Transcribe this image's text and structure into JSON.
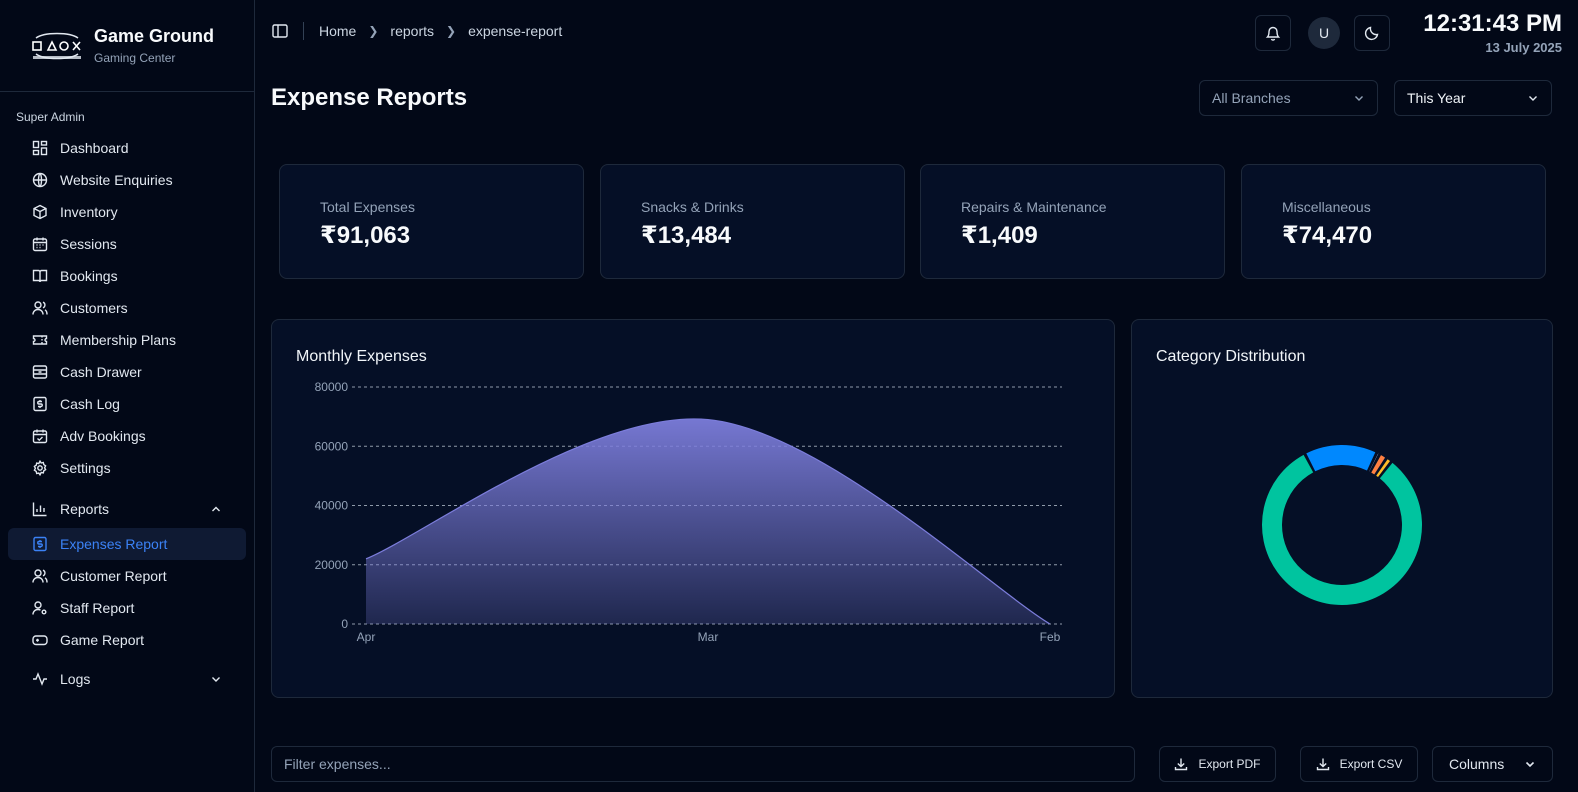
{
  "brand": {
    "name": "Game Ground",
    "subtitle": "Gaming Center"
  },
  "sidebar": {
    "section": "Super Admin",
    "items": [
      {
        "label": "Dashboard",
        "icon": "dashboard-icon"
      },
      {
        "label": "Website Enquiries",
        "icon": "globe-icon"
      },
      {
        "label": "Inventory",
        "icon": "package-icon"
      },
      {
        "label": "Sessions",
        "icon": "calendar-icon"
      },
      {
        "label": "Bookings",
        "icon": "book-icon"
      },
      {
        "label": "Customers",
        "icon": "users-icon"
      },
      {
        "label": "Membership Plans",
        "icon": "ticket-icon"
      },
      {
        "label": "Cash Drawer",
        "icon": "drawer-icon"
      },
      {
        "label": "Cash Log",
        "icon": "dollar-receipt-icon"
      },
      {
        "label": "Adv Bookings",
        "icon": "calendar-check-icon"
      },
      {
        "label": "Settings",
        "icon": "gear-icon"
      }
    ],
    "reports_group": {
      "label": "Reports",
      "children": [
        {
          "label": "Expenses Report",
          "active": true
        },
        {
          "label": "Customer Report"
        },
        {
          "label": "Staff Report"
        },
        {
          "label": "Game Report"
        }
      ]
    },
    "logs_group": {
      "label": "Logs"
    }
  },
  "header": {
    "breadcrumb": [
      "Home",
      "reports",
      "expense-report"
    ],
    "avatar": "U",
    "time": "12:31:43 PM",
    "date": "13 July 2025"
  },
  "page": {
    "title": "Expense Reports",
    "branch_select": "All Branches",
    "period_select": "This Year"
  },
  "stats": [
    {
      "label": "Total Expenses",
      "value": "₹91,063"
    },
    {
      "label": "Snacks & Drinks",
      "value": "₹13,484"
    },
    {
      "label": "Repairs & Maintenance",
      "value": "₹1,409"
    },
    {
      "label": "Miscellaneous",
      "value": "₹74,470"
    }
  ],
  "charts": {
    "monthly_title": "Monthly Expenses",
    "category_title": "Category Distribution"
  },
  "chart_data": [
    {
      "type": "area",
      "title": "Monthly Expenses",
      "x": [
        "Apr",
        "Mar",
        "Feb"
      ],
      "values": [
        22000,
        69000,
        0
      ],
      "ylim": [
        0,
        80000
      ],
      "yticks": [
        0,
        20000,
        40000,
        60000,
        80000
      ],
      "grid": true,
      "color": "#7c7ddb"
    },
    {
      "type": "pie",
      "title": "Category Distribution",
      "slices": [
        {
          "value": 74470,
          "color": "#00c49f"
        },
        {
          "value": 13484,
          "color": "#0088fe"
        },
        {
          "value": 600,
          "color": "#c7d2fe"
        },
        {
          "value": 1409,
          "color": "#ff8042"
        },
        {
          "value": 1100,
          "color": "#ffbb28"
        }
      ]
    }
  ],
  "table_toolbar": {
    "filter_placeholder": "Filter expenses...",
    "export_pdf": "Export PDF",
    "export_csv": "Export CSV",
    "columns": "Columns"
  }
}
